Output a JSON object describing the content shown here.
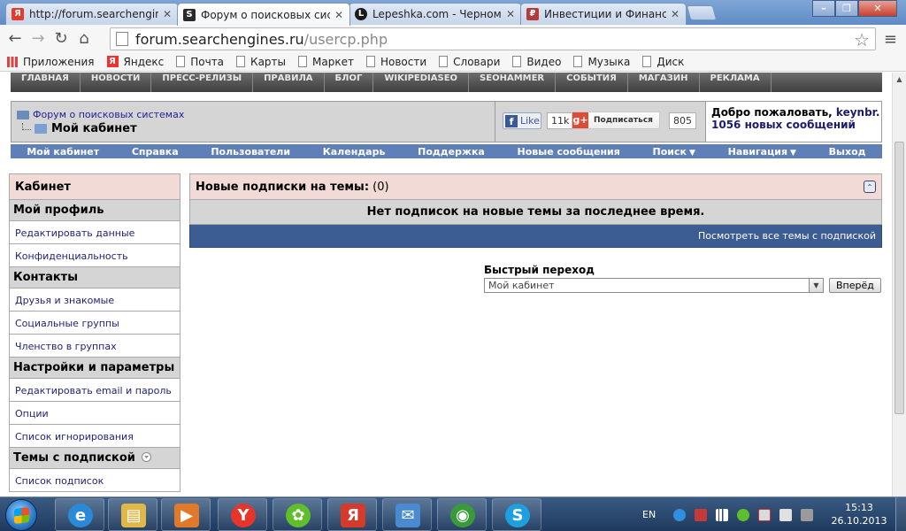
{
  "browser": {
    "tabs": [
      {
        "title": "http://forum.searchengines",
        "favicon": "yandex-icon",
        "color": "#e33b2e",
        "glyph": "Я"
      },
      {
        "title": "Форум о поисковых систе",
        "favicon": "searchengines-icon",
        "color": "#2a2a2a",
        "glyph": "S"
      },
      {
        "title": "Lepeshka.com - Черномо",
        "favicon": "lepeshka-icon",
        "color": "#1a1a1a",
        "glyph": "L"
      },
      {
        "title": "Инвестиции и Финансы",
        "favicon": "finance-icon",
        "color": "#b43b3b",
        "glyph": "₽"
      }
    ],
    "active_tab": 1,
    "url_host": "forum.searchengines.ru",
    "url_path": "/usercp.php",
    "bookmarks": [
      {
        "label": "Приложения",
        "icon": "apps-icon"
      },
      {
        "label": "Яндекс",
        "icon": "yandex-icon"
      },
      {
        "label": "Почта",
        "icon": "page-icon"
      },
      {
        "label": "Карты",
        "icon": "page-icon"
      },
      {
        "label": "Маркет",
        "icon": "page-icon"
      },
      {
        "label": "Новости",
        "icon": "page-icon"
      },
      {
        "label": "Словари",
        "icon": "page-icon"
      },
      {
        "label": "Видео",
        "icon": "page-icon"
      },
      {
        "label": "Музыка",
        "icon": "page-icon"
      },
      {
        "label": "Диск",
        "icon": "page-icon"
      }
    ]
  },
  "site_nav": [
    "ГЛАВНАЯ",
    "НОВОСТИ",
    "ПРЕСС-РЕЛИЗЫ",
    "ПРАВИЛА",
    "БЛОГ",
    "WIKIPEDIASEO",
    "SEOHAMMER",
    "СОБЫТИЯ",
    "МАГАЗИН",
    "РЕКЛАМА"
  ],
  "breadcrumb": {
    "forum": "Форум о поисковых системах",
    "current": "Мой кабинет"
  },
  "social": {
    "like_label": "Like",
    "like_count": "11k",
    "subscribe_label": "Подписаться",
    "subscribe_count": "805"
  },
  "welcome": {
    "greeting": "Добро пожаловать,",
    "username": "keynbr.",
    "new_messages": "1056 новых сообщений"
  },
  "user_nav": [
    {
      "label": "Мой кабинет",
      "dropdown": false
    },
    {
      "label": "Справка",
      "dropdown": false
    },
    {
      "label": "Пользователи",
      "dropdown": false
    },
    {
      "label": "Календарь",
      "dropdown": false
    },
    {
      "label": "Поддержка",
      "dropdown": false
    },
    {
      "label": "Новые сообщения",
      "dropdown": false
    },
    {
      "label": "Поиск",
      "dropdown": true
    },
    {
      "label": "Навигация",
      "dropdown": true
    },
    {
      "label": "Выход",
      "dropdown": false
    }
  ],
  "sidebar": {
    "title": "Кабинет",
    "sections": [
      {
        "title": "Мой профиль",
        "items": [
          "Редактировать данные",
          "Конфиденциальность"
        ]
      },
      {
        "title": "Контакты",
        "items": [
          "Друзья и знакомые",
          "Социальные группы",
          "Членство в группах"
        ]
      },
      {
        "title": "Настройки и параметры",
        "items": [
          "Редактировать email и пароль",
          "Опции",
          "Список игнорирования"
        ]
      },
      {
        "title": "Темы с подпиской",
        "items": [
          "Список подписок"
        ],
        "dropdown": true
      }
    ]
  },
  "subscriptions": {
    "title": "Новые подписки на темы:",
    "count": "(0)",
    "empty_message": "Нет подписок на новые темы за последнее время.",
    "view_all": "Посмотреть все темы с подпиской"
  },
  "quick_jump": {
    "label": "Быстрый переход",
    "selected": "Мой кабинет",
    "go_label": "Вперёд"
  },
  "taskbar": {
    "apps": [
      {
        "name": "ie-icon",
        "color": "#2b8ad8",
        "glyph": "e"
      },
      {
        "name": "explorer-icon",
        "color": "#e0b84a",
        "glyph": "▤"
      },
      {
        "name": "media-player-icon",
        "color": "#e07a2a",
        "glyph": "▶"
      },
      {
        "name": "yandex-browser-icon",
        "color": "#e8352a",
        "glyph": "Y"
      },
      {
        "name": "icq-icon",
        "color": "#5fbf2a",
        "glyph": "✿"
      },
      {
        "name": "yandex-icon",
        "color": "#d63a2a",
        "glyph": "Я"
      },
      {
        "name": "mail-icon",
        "color": "#4a8ad0",
        "glyph": "✉"
      },
      {
        "name": "chrome-icon",
        "color": "#3a9a3a",
        "glyph": "◉"
      },
      {
        "name": "skype-icon",
        "color": "#1ea0e0",
        "glyph": "S"
      }
    ],
    "language": "EN",
    "time": "15:13",
    "date": "26.10.2013"
  }
}
